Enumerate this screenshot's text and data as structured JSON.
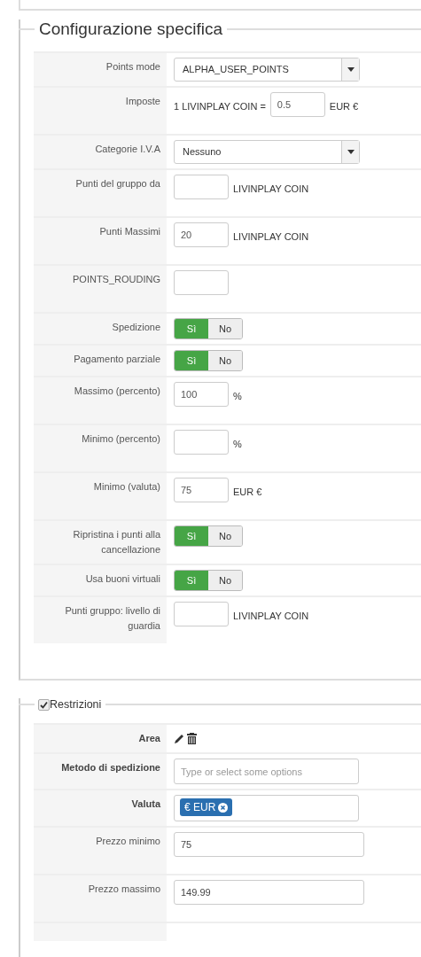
{
  "sections": [
    {
      "legend": "Configurazione specifica",
      "legend_checkbox": false,
      "rows": [
        {
          "label": "Points mode",
          "bold": false,
          "kind": "select",
          "value": "ALPHA_USER_POINTS"
        },
        {
          "label": "Imposte",
          "bold": false,
          "kind": "rate",
          "prefix": "1 LIVINPLAY COIN =",
          "value": "0.5",
          "suffix": "EUR €"
        },
        {
          "label": "Categorie I.V.A",
          "bold": false,
          "kind": "select",
          "value": "Nessuno"
        },
        {
          "label": "Punti del gruppo da",
          "bold": false,
          "kind": "input",
          "suffix": "LIVINPLAY COIN"
        },
        {
          "label": "Punti Massimi",
          "bold": false,
          "kind": "input",
          "value": "20",
          "suffix": "LIVINPLAY COIN"
        },
        {
          "label": "POINTS_ROUDING",
          "bold": false,
          "kind": "input"
        },
        {
          "label": "Spedizione",
          "bold": false,
          "kind": "toggle",
          "options": [
            {
              "label": "Sì",
              "selected": true
            },
            {
              "label": "No",
              "selected": false
            }
          ]
        },
        {
          "label": "Pagamento parziale",
          "bold": false,
          "kind": "toggle",
          "options": [
            {
              "label": "Sì",
              "selected": true
            },
            {
              "label": "No",
              "selected": false
            }
          ]
        },
        {
          "label": "Massimo (percento)",
          "bold": false,
          "kind": "input",
          "value": "100",
          "suffix": "%"
        },
        {
          "label": "Minimo (percento)",
          "bold": false,
          "kind": "input",
          "suffix": "%"
        },
        {
          "label": "Minimo (valuta)",
          "bold": false,
          "kind": "input",
          "value": "75",
          "suffix": "EUR €"
        },
        {
          "label": "Ripristina i punti alla cancellazione",
          "bold": false,
          "kind": "toggle",
          "options": [
            {
              "label": "Sì",
              "selected": true
            },
            {
              "label": "No",
              "selected": false
            }
          ]
        },
        {
          "label": "Usa buoni virtuali",
          "bold": false,
          "kind": "toggle",
          "options": [
            {
              "label": "Sì",
              "selected": true
            },
            {
              "label": "No",
              "selected": false
            }
          ]
        },
        {
          "label": "Punti gruppo: livello di guardia",
          "bold": false,
          "kind": "input",
          "suffix": "LIVINPLAY COIN"
        }
      ]
    },
    {
      "legend": "Restrizioni",
      "legend_checkbox": true,
      "checked": true,
      "rows": [
        {
          "label": "Area",
          "bold": true,
          "kind": "icons"
        },
        {
          "label": "Metodo di spedizione",
          "bold": true,
          "kind": "multiselect",
          "placeholder": "Type or select some options"
        },
        {
          "label": "Valuta",
          "bold": true,
          "kind": "tags",
          "tags": [
            "€ EUR"
          ]
        },
        {
          "label": "Prezzo minimo",
          "bold": false,
          "kind": "wide",
          "value": "75"
        },
        {
          "label": "Prezzo massimo",
          "bold": false,
          "kind": "wide",
          "value": "149.99"
        },
        {
          "kind": "empty"
        }
      ]
    }
  ]
}
